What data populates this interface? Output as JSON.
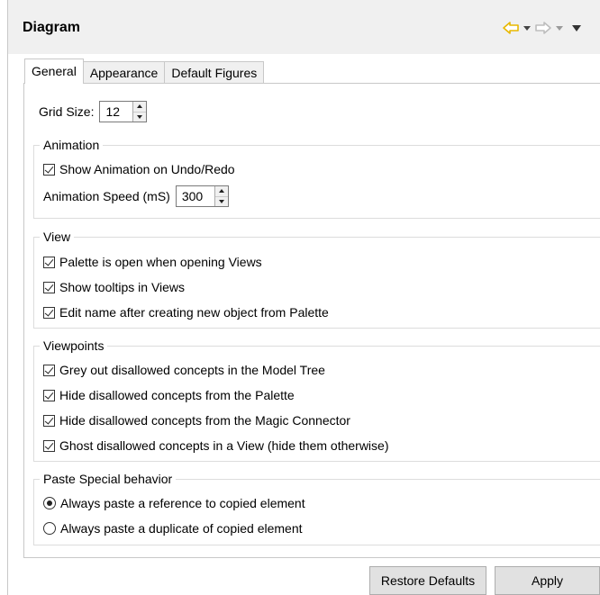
{
  "header": {
    "title": "Diagram"
  },
  "colors": {
    "back_arrow": "#e8b800",
    "forward_arrow": "#bdbdbd"
  },
  "tabs": [
    {
      "label": "General",
      "active": true
    },
    {
      "label": "Appearance",
      "active": false
    },
    {
      "label": "Default Figures",
      "active": false
    }
  ],
  "grid": {
    "label": "Grid Size:",
    "value": "12"
  },
  "animation": {
    "legend": "Animation",
    "show_label": "Show Animation on Undo/Redo",
    "show_checked": true,
    "speed_label": "Animation Speed (mS)",
    "speed_value": "300"
  },
  "view": {
    "legend": "View",
    "items": [
      {
        "label": "Palette is open when opening Views",
        "checked": true
      },
      {
        "label": "Show tooltips in Views",
        "checked": true
      },
      {
        "label": "Edit name after creating new object from Palette",
        "checked": true
      }
    ]
  },
  "viewpoints": {
    "legend": "Viewpoints",
    "items": [
      {
        "label": "Grey out disallowed concepts in the Model Tree",
        "checked": true
      },
      {
        "label": "Hide disallowed concepts from the Palette",
        "checked": true
      },
      {
        "label": "Hide disallowed concepts from the Magic Connector",
        "checked": true
      },
      {
        "label": "Ghost disallowed concepts in a View (hide them otherwise)",
        "checked": true
      }
    ]
  },
  "paste": {
    "legend": "Paste Special behavior",
    "options": [
      {
        "label": "Always paste a reference to copied element",
        "selected": true
      },
      {
        "label": "Always paste a duplicate of copied element",
        "selected": false
      }
    ]
  },
  "buttons": {
    "restore": "Restore Defaults",
    "apply": "Apply"
  }
}
